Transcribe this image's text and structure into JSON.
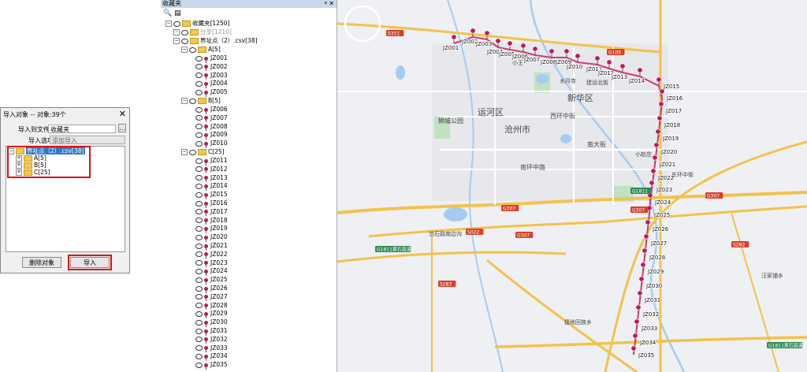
{
  "dialog": {
    "title": "导入对象 -- 对象:39个",
    "close_glyph": "✕",
    "folder_label": "导入到文件夹",
    "folder_value": "收藏夹",
    "browse_label": "...",
    "option_label": "导入选项",
    "option_value": "添加导入",
    "tree": [
      {
        "label": "界址点（2）.csv[38]",
        "selected": true
      },
      {
        "label": "A[5]"
      },
      {
        "label": "B[5]"
      },
      {
        "label": "C[25]"
      }
    ],
    "delete_button": "删除对象",
    "import_button": "导入"
  },
  "favorites": {
    "title": "收藏夹",
    "pin_glyph": "ᵠ",
    "close_glyph": "✕",
    "root": "收藏夹[1250]",
    "shared": "分享[1210]",
    "file": "界址点（2）.csv[38]",
    "groups": [
      {
        "label": "A[5]",
        "items": [
          "JZ001",
          "JZ002",
          "JZ003",
          "JZ004",
          "JZ005"
        ]
      },
      {
        "label": "B[5]",
        "items": [
          "JZ006",
          "JZ007",
          "JZ008",
          "JZ009",
          "JZ010"
        ]
      },
      {
        "label": "C[25]",
        "items": [
          "JZ011",
          "JZ012",
          "JZ013",
          "JZ014",
          "JZ015",
          "JZ016",
          "JZ017",
          "JZ018",
          "JZ019",
          "JZ020",
          "JZ021",
          "JZ022",
          "JZ023",
          "JZ024",
          "JZ025",
          "JZ026",
          "JZ027",
          "JZ028",
          "JZ029",
          "JZ030",
          "JZ031",
          "JZ032",
          "JZ033",
          "JZ034",
          "JZ035"
        ]
      }
    ]
  },
  "map": {
    "places": [
      "运河区",
      "新华区",
      "沧州市",
      "狮城公园",
      "南大街",
      "南环中路",
      "西环中街",
      "小王",
      "水月寺",
      "建设北街",
      "东环中街",
      "小赵庄",
      "汪家铺乡",
      "捷地回族乡",
      "沧石路南边沟"
    ],
    "road_badges": [
      "S351",
      "G105",
      "G307",
      "G307",
      "G307",
      "G307",
      "G1811黄石高速",
      "S282",
      "S022",
      "G1811",
      "G1811黄石高速",
      "S283"
    ],
    "marker_labels": [
      "JZ001",
      "JZ002",
      "JZ003",
      "JZ004",
      "JZ005",
      "JZ006",
      "JZ007",
      "JZ008",
      "JZ009",
      "JZ010",
      "JZ011",
      "JZ012",
      "JZ013",
      "JZ014",
      "JZ015",
      "JZ016",
      "JZ017",
      "JZ018",
      "JZ019",
      "JZ020",
      "JZ021",
      "JZ022",
      "JZ023",
      "JZ024",
      "JZ025",
      "JZ026",
      "JZ027",
      "JZ028",
      "JZ029",
      "JZ030",
      "JZ031",
      "JZ032",
      "JZ033",
      "JZ034",
      "JZ035"
    ],
    "colors": {
      "marker": "#c2185b",
      "route": "#d43b6e",
      "highway": "#f4c24a",
      "badge_red": "#d9412b",
      "badge_green": "#2e8b57"
    }
  }
}
